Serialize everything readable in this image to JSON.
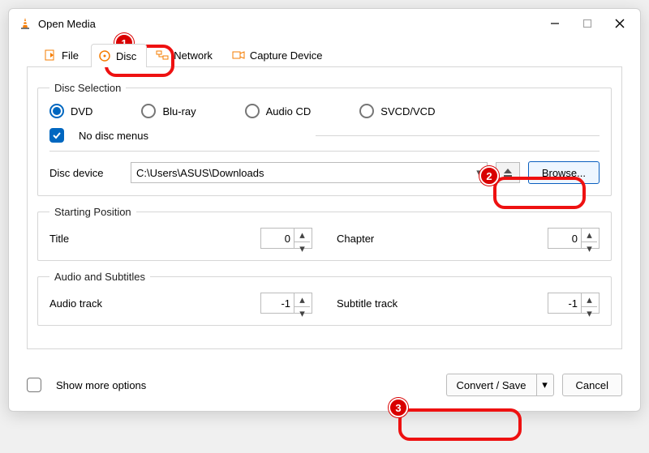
{
  "window": {
    "title": "Open Media"
  },
  "tabs": {
    "file": "File",
    "disc": "Disc",
    "network": "Network",
    "capture": "Capture Device"
  },
  "disc_selection": {
    "legend": "Disc Selection",
    "radios": {
      "dvd": "DVD",
      "bluray": "Blu-ray",
      "audiocd": "Audio CD",
      "svcd": "SVCD/VCD"
    },
    "no_disc_menus": "No disc menus",
    "disc_device_label": "Disc device",
    "disc_device_value": "C:\\Users\\ASUS\\Downloads",
    "browse_label": "Browse..."
  },
  "starting_position": {
    "legend": "Starting Position",
    "title_label": "Title",
    "title_value": "0",
    "chapter_label": "Chapter",
    "chapter_value": "0"
  },
  "audio_subs": {
    "legend": "Audio and Subtitles",
    "audio_label": "Audio track",
    "audio_value": "-1",
    "subtitle_label": "Subtitle track",
    "subtitle_value": "-1"
  },
  "footer": {
    "show_more": "Show more options",
    "convert_save": "Convert / Save",
    "cancel": "Cancel"
  },
  "annotations": {
    "b1": "1",
    "b2": "2",
    "b3": "3"
  }
}
